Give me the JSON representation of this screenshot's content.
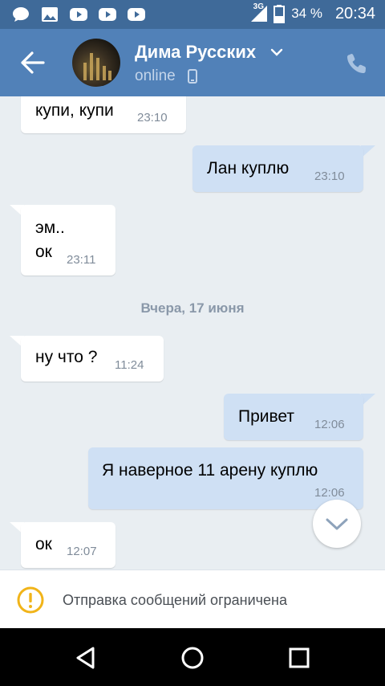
{
  "status_bar": {
    "network": "3G",
    "battery": "34 %",
    "time": "20:34",
    "left_icons": [
      "chat-bubble-icon",
      "image-icon",
      "youtube-icon",
      "youtube-icon",
      "youtube-icon"
    ]
  },
  "header": {
    "contact_name": "Дима Русских",
    "status": "online"
  },
  "messages": [
    {
      "side": "in",
      "text": "купи, купи",
      "time": "23:10"
    },
    {
      "side": "out",
      "text": "Лан куплю",
      "time": "23:10"
    },
    {
      "side": "in",
      "text": "эм..\nок",
      "time": "23:11"
    },
    {
      "side": "in",
      "text": "ну что ?",
      "time": "11:24"
    },
    {
      "side": "out",
      "text": "Привет",
      "time": "12:06"
    },
    {
      "side": "out",
      "text": "Я наверное 11 арену куплю",
      "time": "12:06"
    },
    {
      "side": "in",
      "text": "ок",
      "time": "12:07"
    }
  ],
  "date_separator": "Вчера, 17 июня",
  "restriction_notice": "Отправка сообщений ограничена",
  "colors": {
    "header": "#5181b8",
    "status_bar": "#3f6a99",
    "chat_background": "#e9eef2",
    "outgoing_bubble": "#cfe0f4",
    "incoming_bubble": "#ffffff",
    "warning": "#f1b419"
  }
}
